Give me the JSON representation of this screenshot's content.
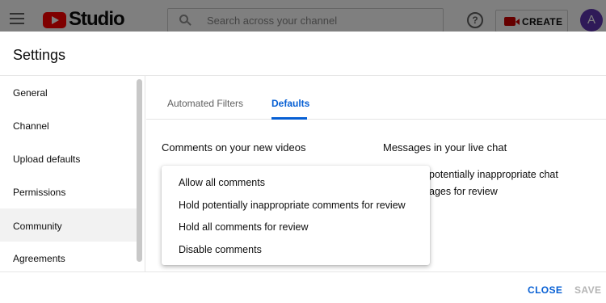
{
  "header": {
    "logo_text": "Studio",
    "search_placeholder": "Search across your channel",
    "help_symbol": "?",
    "create_label": "CREATE",
    "avatar_initial": "A"
  },
  "dialog": {
    "title": "Settings",
    "sidebar": {
      "items": [
        {
          "label": "General",
          "active": false
        },
        {
          "label": "Channel",
          "active": false
        },
        {
          "label": "Upload defaults",
          "active": false
        },
        {
          "label": "Permissions",
          "active": false
        },
        {
          "label": "Community",
          "active": true
        },
        {
          "label": "Agreements",
          "active": false
        }
      ]
    },
    "tabs": [
      {
        "label": "Automated Filters",
        "active": false
      },
      {
        "label": "Defaults",
        "active": true
      }
    ],
    "comments_heading": "Comments on your new videos",
    "livechat_heading": "Messages in your live chat",
    "livechat_partial_line1": "potentially inappropriate chat",
    "livechat_partial_line2": "ages for review",
    "dropdown_options": [
      "Allow all comments",
      "Hold potentially inappropriate comments for review",
      "Hold all comments for review",
      "Disable comments"
    ],
    "close_label": "CLOSE",
    "save_label": "SAVE"
  },
  "colors": {
    "accent": "#065fd4",
    "brand_red": "#ff0000",
    "avatar": "#5e35b1",
    "disabled": "#b5b5b5"
  }
}
